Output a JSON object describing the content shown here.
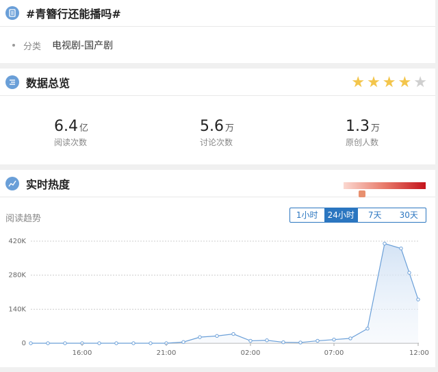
{
  "topic": {
    "title": "#青簪行还能播吗#",
    "category_label": "分类",
    "category_value": "电视剧-国产剧"
  },
  "overview": {
    "title": "数据总览",
    "rating_stars": 4,
    "rating_max": 5,
    "stats": [
      {
        "value": "6.4",
        "unit": "亿",
        "label": "阅读次数"
      },
      {
        "value": "5.6",
        "unit": "万",
        "label": "讨论次数"
      },
      {
        "value": "1.3",
        "unit": "万",
        "label": "原创人数"
      }
    ]
  },
  "heat": {
    "title": "实时热度",
    "trend_label": "阅读趋势",
    "tabs": [
      {
        "label": "1小时",
        "active": false
      },
      {
        "label": "24小时",
        "active": true
      },
      {
        "label": "7天",
        "active": false
      },
      {
        "label": "30天",
        "active": false
      }
    ]
  },
  "colors": {
    "accent": "#2b76c0",
    "line": "#6a9fd8",
    "star": "#f3c54b",
    "heat_high": "#c4141c"
  },
  "chart_data": {
    "type": "area",
    "x": [
      "13:00",
      "14:00",
      "15:00",
      "16:00",
      "17:00",
      "18:00",
      "19:00",
      "20:00",
      "21:00",
      "22:00",
      "23:00",
      "00:00",
      "01:00",
      "02:00",
      "03:00",
      "04:00",
      "05:00",
      "06:00",
      "07:00",
      "08:00",
      "09:00",
      "09:30",
      "10:00",
      "11:00",
      "12:00"
    ],
    "values": [
      0,
      0,
      0,
      0,
      0,
      0,
      0,
      0,
      0,
      5000,
      25000,
      30000,
      38000,
      10000,
      12000,
      4000,
      3000,
      10000,
      15000,
      20000,
      60000,
      410000,
      390000,
      290000,
      180000
    ],
    "xticks": [
      "16:00",
      "21:00",
      "02:00",
      "07:00",
      "12:00"
    ],
    "yticks": [
      "0",
      "140K",
      "280K",
      "420K"
    ],
    "ylim": [
      0,
      420000
    ]
  }
}
